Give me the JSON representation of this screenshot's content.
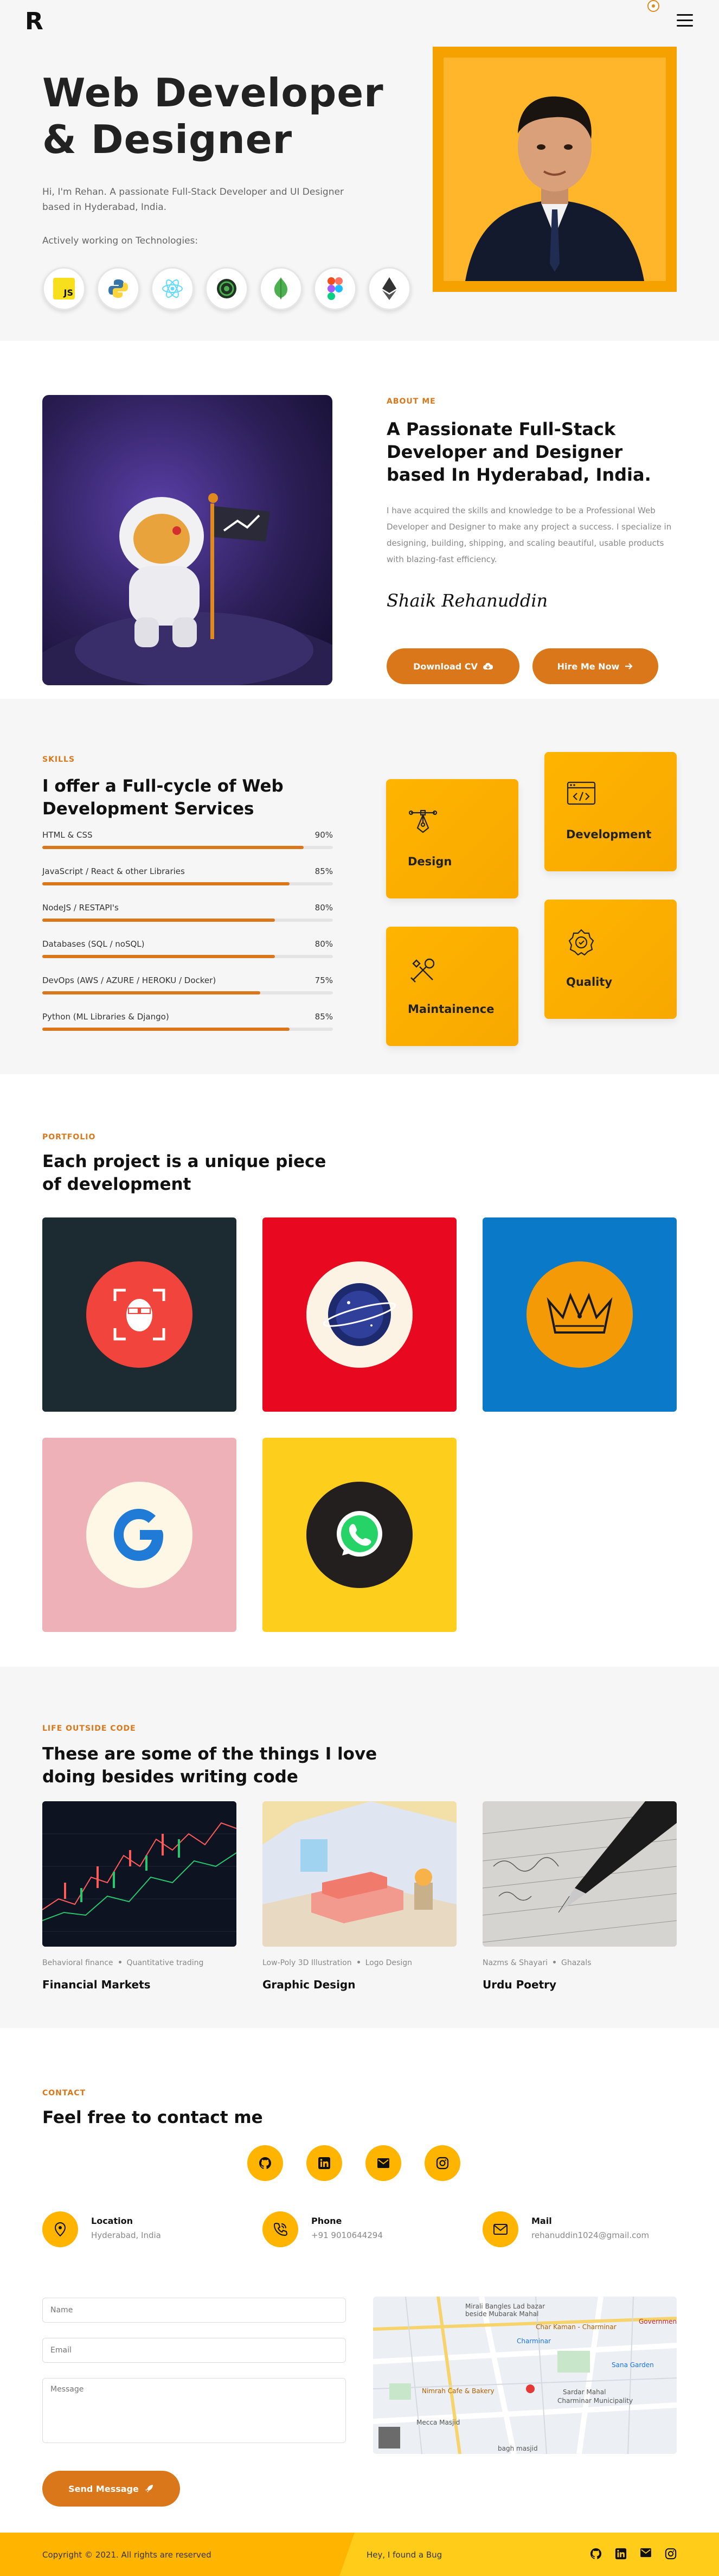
{
  "header": {
    "logo": "R"
  },
  "hero": {
    "title_line1": "Web Developer",
    "title_line2": "& Designer",
    "intro": "Hi, I'm Rehan. A passionate Full-Stack Developer and UI Designer based in Hyderabad, India.",
    "tech_label": "Actively working on Technologies:",
    "techs": [
      "javascript-icon",
      "python-icon",
      "react-icon",
      "rstudio-icon",
      "mongodb-icon",
      "figma-icon",
      "ethereum-icon"
    ],
    "js_badge": "JS"
  },
  "about": {
    "eyebrow": "ABOUT ME",
    "heading": "A Passionate Full-Stack Developer and Designer based In Hyderabad, India.",
    "description": "I have acquired the skills and knowledge to be a Professional Web Developer and Designer to make any project a success. I specialize in designing, building, shipping, and scaling beautiful, usable products with blazing-fast efficiency.",
    "signature": "Shaik Rehanuddin",
    "download_label": "Download CV",
    "hire_label": "Hire Me Now"
  },
  "skills": {
    "eyebrow": "SKILLS",
    "heading": "I offer a Full-cycle of Web Development Services",
    "bars": [
      {
        "name": "HTML & CSS",
        "percent": "90%",
        "value": 90
      },
      {
        "name": "JavaScript / React & other Libraries",
        "percent": "85%",
        "value": 85
      },
      {
        "name": "NodeJS / RESTAPI's",
        "percent": "80%",
        "value": 80
      },
      {
        "name": "Databases (SQL / noSQL)",
        "percent": "80%",
        "value": 80
      },
      {
        "name": "DevOps (AWS / AZURE / HEROKU / Docker)",
        "percent": "75%",
        "value": 75
      },
      {
        "name": "Python (ML Libraries & Django)",
        "percent": "85%",
        "value": 85
      }
    ],
    "cards": {
      "design": "Design",
      "development": "Development",
      "maintainence": "Maintainence",
      "quality": "Quality"
    }
  },
  "portfolio": {
    "eyebrow": "PORTFOLIO",
    "heading": "Each project is a unique piece of development",
    "colors": [
      "#1c2b31",
      "#e8081f",
      "#0a79c8",
      "#efb1b8",
      "#fdcf1c"
    ]
  },
  "hobbies": {
    "eyebrow": "LIFE OUTSIDE CODE",
    "heading": "These are some of the things I love doing besides writing code",
    "items": [
      {
        "tag1": "Behavioral finance",
        "tag2": "Quantitative trading",
        "title": "Financial Markets"
      },
      {
        "tag1": "Low-Poly 3D Illustration",
        "tag2": "Logo Design",
        "title": "Graphic Design"
      },
      {
        "tag1": "Nazms & Shayari",
        "tag2": "Ghazals",
        "title": "Urdu Poetry"
      }
    ]
  },
  "contact": {
    "eyebrow": "CONTACT",
    "heading": "Feel free to contact me",
    "location_label": "Location",
    "location_value": "Hyderabad, India",
    "phone_label": "Phone",
    "phone_value": "+91 9010644294",
    "mail_label": "Mail",
    "mail_value": "rehanuddin1024@gmail.com",
    "name_placeholder": "Name",
    "email_placeholder": "Email",
    "message_placeholder": "Message",
    "send_label": "Send Message",
    "map_labels": {
      "l1": "Mirali Bangles Lad bazar",
      "l2": "beside Mubarak Mahal",
      "l3": "Char Kaman - Charminar",
      "l4": "Charminar",
      "l5": "Sardar Mahal",
      "l6": "Charminar Municipality",
      "l7": "Nimrah Cafe & Bakery",
      "l8": "Mecca Masjid",
      "l9": "Sana Garden",
      "l10": "Government",
      "l11": "bagh masjid"
    }
  },
  "footer": {
    "copyright": "Copyright © 2021. All rights are reserved",
    "bug": "Hey, I found a Bug"
  }
}
